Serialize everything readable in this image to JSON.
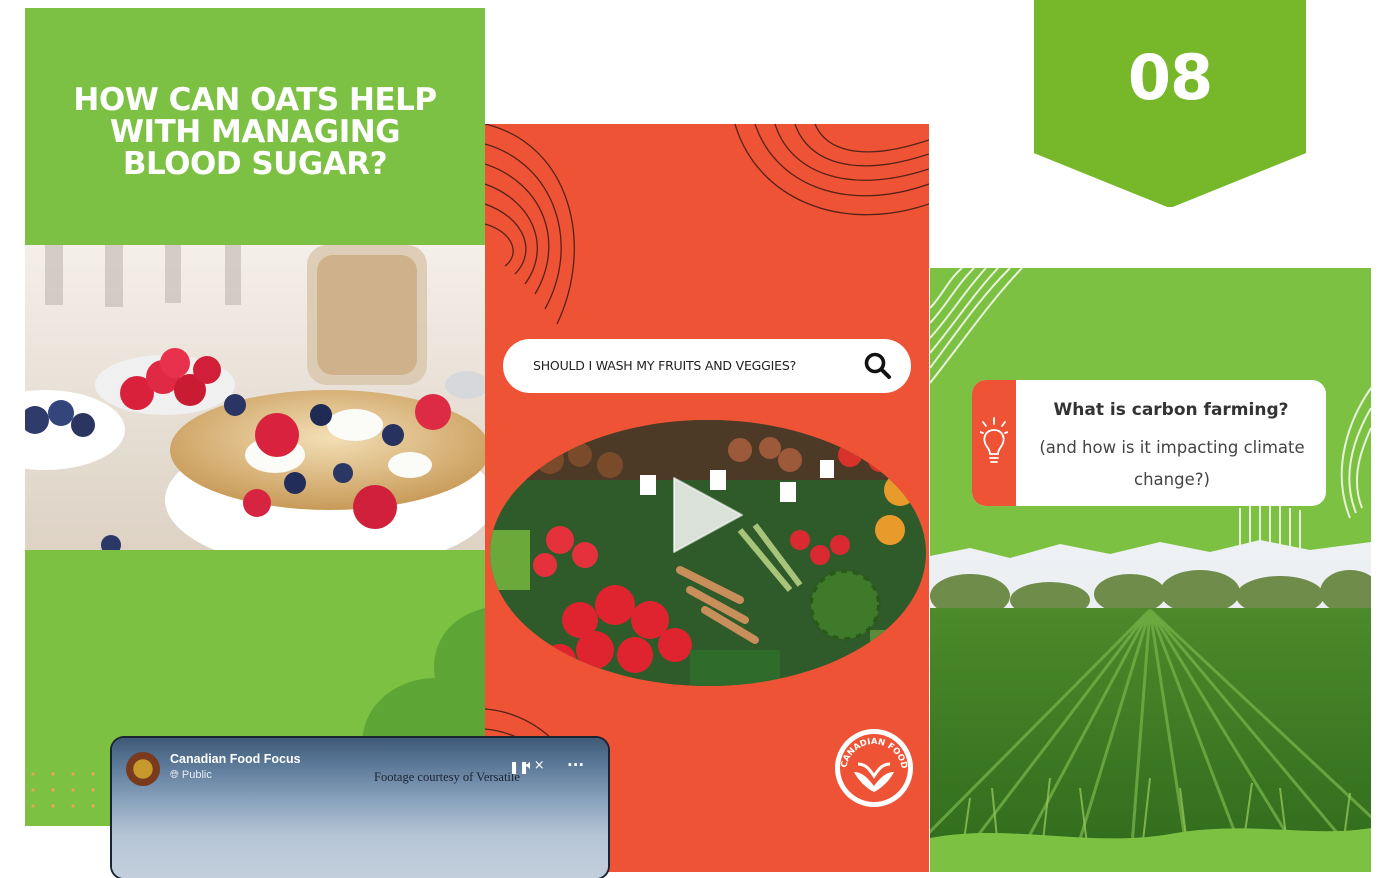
{
  "badge": {
    "number": "08",
    "color": "#76b82a"
  },
  "card_oats": {
    "title": "HOW CAN OATS HELP WITH MANAGING BLOOD SUGAR?",
    "background": "#7dc142"
  },
  "card_wash": {
    "search_text": "SHOULD I WASH MY FRUITS AND VEGGIES?",
    "search_icon": "search-icon",
    "play_icon": "play-icon",
    "logo_text": "CANADIAN FOOD FOCUS",
    "background": "#ef5336"
  },
  "card_carbon": {
    "question": "What is carbon farming?",
    "subquestion": "(and how is it impacting climate change?)",
    "icon": "lightbulb-icon",
    "accent": "#ef5336",
    "background": "#7dc142"
  },
  "fb_post": {
    "page_name": "Canadian Food Focus",
    "privacy": "Public",
    "credit": "Footage courtesy of Versatile",
    "controls": [
      "pause-icon",
      "mute-icon",
      "more-icon"
    ]
  }
}
